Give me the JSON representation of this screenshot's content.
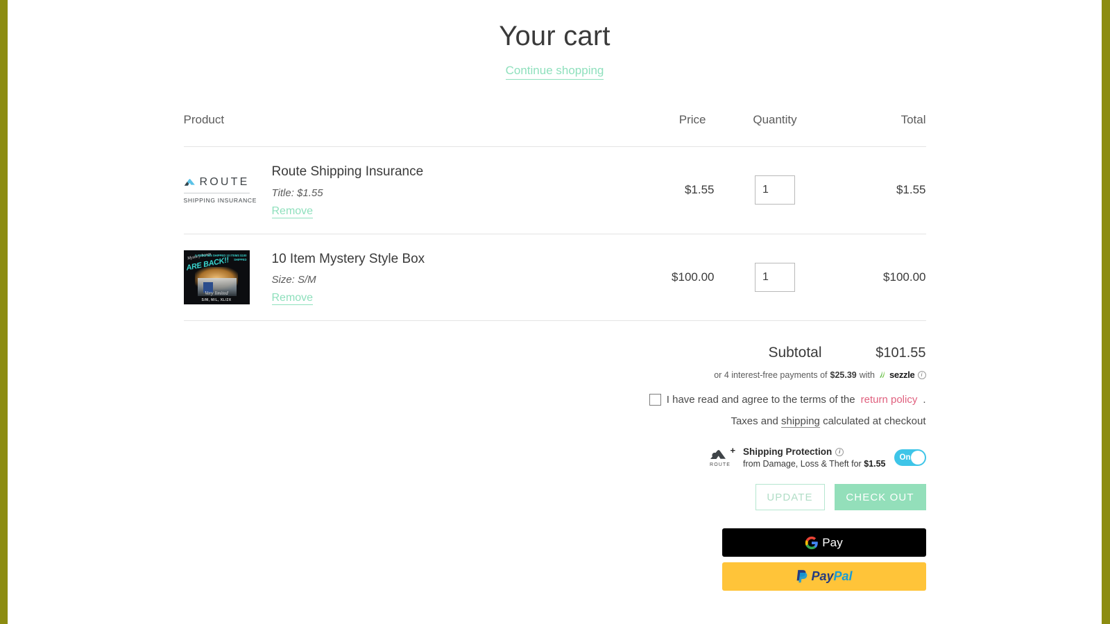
{
  "page": {
    "title": "Your cart",
    "continue_shopping": "Continue shopping"
  },
  "table": {
    "headers": {
      "product": "Product",
      "price": "Price",
      "quantity": "Quantity",
      "total": "Total"
    },
    "rows": [
      {
        "name": "Route Shipping Insurance",
        "variant": "Title: $1.55",
        "remove": "Remove",
        "price": "$1.55",
        "quantity": "1",
        "total": "$1.55",
        "thumb_kind": "route-logo",
        "thumb_text": {
          "word": "ROUTE",
          "sub": "SHIPPING INSURANCE"
        }
      },
      {
        "name": "10 Item Mystery Style Box",
        "variant": "Size: S/M",
        "remove": "Remove",
        "price": "$100.00",
        "quantity": "1",
        "total": "$100.00",
        "thumb_kind": "mystery-box",
        "thumb_text": {
          "line1": "Mystery boxes",
          "line2": "ARE BACK!!",
          "line3": "5 ITEMS $65 SHIPPED 10 ITEMS $100 SHIPPED",
          "line4": "Very limited",
          "line5": "S/M, M/L, XL/2X"
        }
      }
    ]
  },
  "totals": {
    "subtotal_label": "Subtotal",
    "subtotal_value": "$101.55",
    "sezzle": {
      "prefix": "or 4 interest-free payments of",
      "amount": "$25.39",
      "with": "with",
      "brand": "sezzle",
      "info": "i"
    },
    "terms": {
      "text": "I have read and agree to the terms of the",
      "link": "return policy",
      "period": "."
    },
    "taxes": {
      "prefix": "Taxes and",
      "link": "shipping",
      "suffix": "calculated at checkout"
    }
  },
  "route_widget": {
    "brand": "ROUTE",
    "plus": "+",
    "title": "Shipping Protection",
    "info": "i",
    "subtitle_prefix": "from Damage, Loss & Theft for",
    "price": "$1.55",
    "toggle_label": "On"
  },
  "buttons": {
    "update": "UPDATE",
    "checkout": "CHECK OUT",
    "gpay": "Pay",
    "paypal_pay": "Pay",
    "paypal_pal": "Pal"
  },
  "colors": {
    "accent_green": "#8fe0bd",
    "checkout_green": "#93dfba",
    "return_policy_pink": "#e0607e",
    "route_toggle_blue": "#3ec5e8",
    "edge_bar_olive": "#8c8c11",
    "paypal_yellow": "#ffc439"
  }
}
